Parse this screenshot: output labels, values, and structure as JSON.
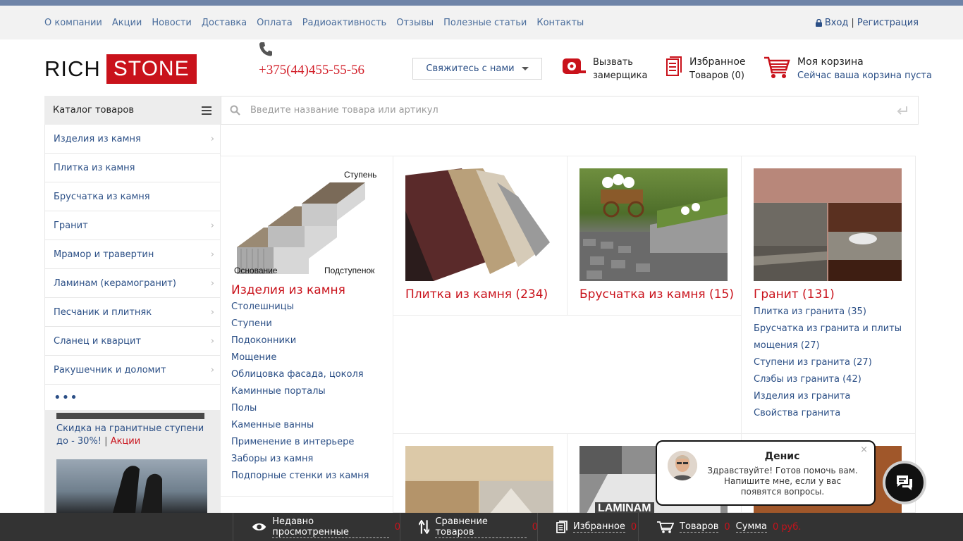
{
  "topnav": {
    "links": [
      "О компании",
      "Акции",
      "Новости",
      "Доставка",
      "Оплата",
      "Радиоактивность",
      "Отзывы",
      "Полезные статьи",
      "Контакты"
    ],
    "login": "Вход",
    "separator": "|",
    "register": "Регистрация"
  },
  "logo": {
    "part1": "RICH",
    "part2": "STONE"
  },
  "header": {
    "phone": "+375(44)455-55-56",
    "contact_button": "Свяжитесь с нами",
    "measurer_line1": "Вызвать",
    "measurer_line2": "замерщика",
    "favorites_title": "Избранное",
    "favorites_count": "Товаров (0)",
    "cart_title": "Моя корзина",
    "cart_status": "Сейчас ваша корзина пуста"
  },
  "catalog": {
    "title": "Каталог товаров",
    "items": [
      {
        "label": "Изделия из камня",
        "arrow": "›"
      },
      {
        "label": "Плитка из камня",
        "arrow": ""
      },
      {
        "label": "Брусчатка из камня",
        "arrow": ""
      },
      {
        "label": "Гранит",
        "arrow": "›"
      },
      {
        "label": "Мрамор и травертин",
        "arrow": "›"
      },
      {
        "label": "Ламинам (керамогранит)",
        "arrow": "›"
      },
      {
        "label": "Песчаник и плитняк",
        "arrow": "›"
      },
      {
        "label": "Сланец и кварцит",
        "arrow": "›"
      },
      {
        "label": "Ракушечник и доломит",
        "arrow": "›"
      }
    ],
    "more": "•••"
  },
  "search": {
    "placeholder": "Введите название товара или артикул"
  },
  "promo": {
    "text": "Скидка на гранитные ступени до - 30%!",
    "sep": "|",
    "link": "Акции"
  },
  "cards": {
    "products": {
      "title": "Изделия из камня",
      "img_label_top": "Ступень",
      "img_label_left": "Основание",
      "img_label_right": "Подступенок",
      "links": [
        "Столешницы",
        "Ступени",
        "Подоконники",
        "Мощение",
        "Облицовка фасада, цоколя",
        "Каминные порталы",
        "Полы",
        "Каменные ванны",
        "Применение в интерьере",
        "Заборы из камня",
        "Подпорные стенки из камня"
      ]
    },
    "tile": {
      "title": "Плитка из камня (234)"
    },
    "paving": {
      "title": "Брусчатка из камня (15)"
    },
    "granite": {
      "title": "Гранит (131)",
      "links": [
        "Плитка из гранита (35)",
        "Брусчатка из гранита и плиты",
        "мощения (27)",
        "Ступени из гранита (27)",
        "Слэбы из гранита (42)",
        "Изделия из гранита",
        "Свойства гранита"
      ]
    },
    "laminam_text": "LAMINAM"
  },
  "chat": {
    "name": "Денис",
    "message": "Здравствуйте! Готов помочь вам. Напишите мне, если у вас появятся вопросы.",
    "close": "×"
  },
  "bottombar": {
    "recent": "Недавно просмотренные",
    "recent_count": "0",
    "compare": "Сравнение товаров",
    "compare_count": "0",
    "favorites": "Избранное",
    "favorites_count": "0",
    "goods": "Товаров",
    "goods_count": "0",
    "sum": "Сумма",
    "sum_value": "0 руб."
  },
  "colors": {
    "accent_red": "#c9121b",
    "link_blue": "#2b4f86",
    "top_stripe": "#6f84a8",
    "bottom_bar": "#333333"
  }
}
